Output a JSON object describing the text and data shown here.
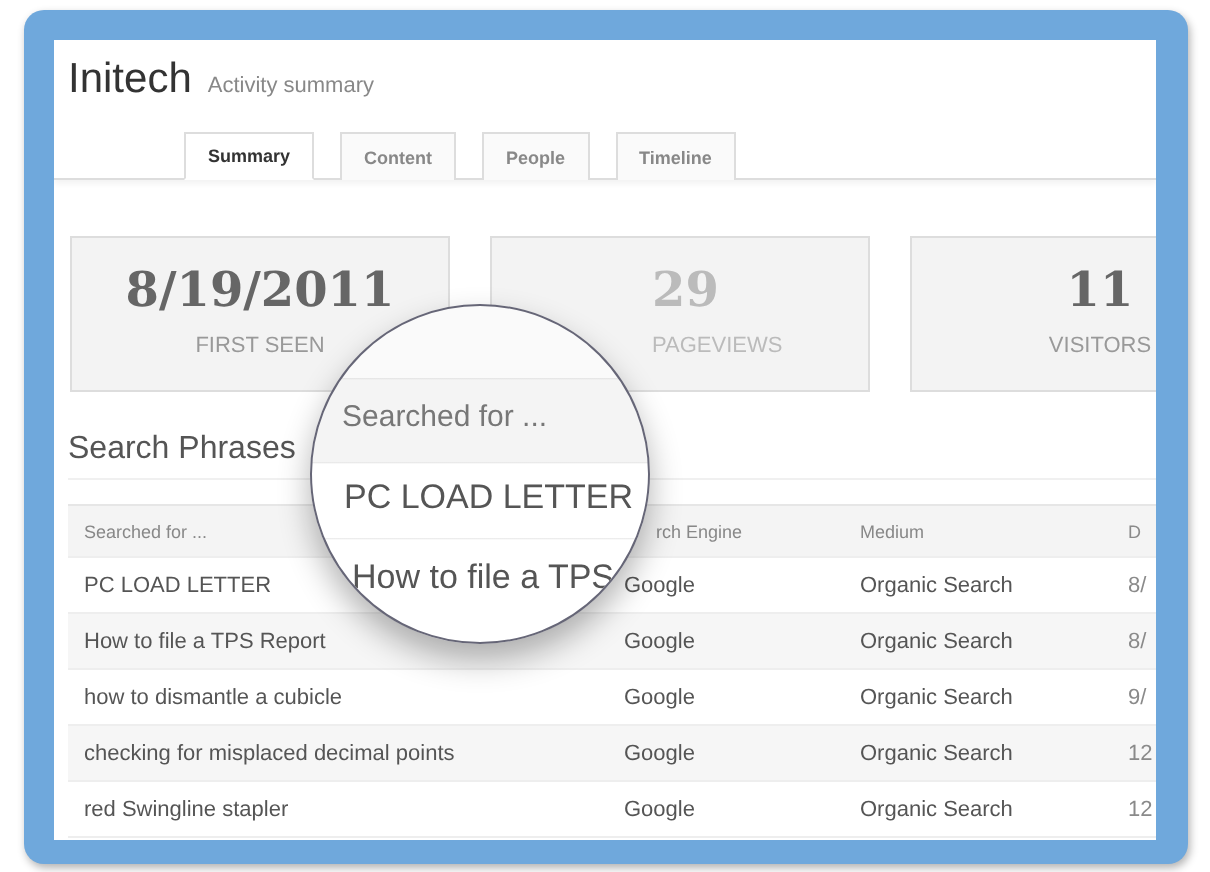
{
  "header": {
    "title": "Initech",
    "subtitle": "Activity summary"
  },
  "tabs": [
    {
      "label": "Summary",
      "selected": true
    },
    {
      "label": "Content",
      "selected": false
    },
    {
      "label": "People",
      "selected": false
    },
    {
      "label": "Timeline",
      "selected": false
    }
  ],
  "stats": [
    {
      "value": "8/19/2011",
      "label": "FIRST SEEN"
    },
    {
      "value": "29",
      "label": "PAGEVIEWS"
    },
    {
      "value": "11",
      "label": "VISITORS"
    }
  ],
  "section_title": "Search Phrases",
  "table": {
    "columns": [
      "Searched for ...",
      "rch Engine",
      "Medium",
      "D"
    ],
    "rows": [
      {
        "cells": [
          "PC LOAD LETTER",
          "Google",
          "Organic Search",
          "8/"
        ]
      },
      {
        "cells": [
          "How to file a TPS Report",
          "Google",
          "Organic Search",
          "8/"
        ]
      },
      {
        "cells": [
          "how to dismantle a cubicle",
          "Google",
          "Organic Search",
          "9/"
        ]
      },
      {
        "cells": [
          "checking for misplaced decimal points",
          "Google",
          "Organic Search",
          "12"
        ]
      },
      {
        "cells": [
          "red Swingline stapler",
          "Google",
          "Organic Search",
          "12"
        ]
      }
    ]
  },
  "magnifier": {
    "header": "Searched for ...",
    "rows": [
      "PC LOAD LETTER",
      "How to file a TPS"
    ]
  }
}
